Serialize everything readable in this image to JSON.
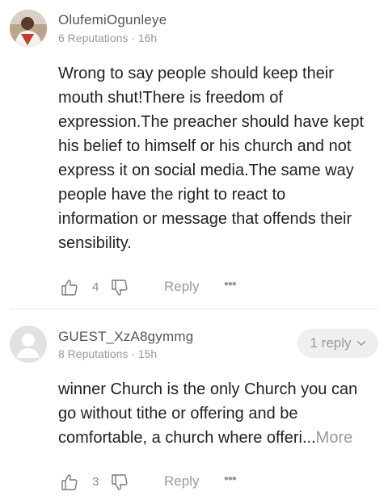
{
  "comments": [
    {
      "username": "OlufemiOgunleye",
      "reputations": "6 Reputations",
      "time": "16h",
      "text_lines": [
        "Wrong to say people should keep their",
        "mouth shut!There is freedom of",
        "expression.The preacher should have kept",
        "his belief to himself or his church and not",
        "express it on social media.The same way",
        "people have the right to react to",
        "information or message that offends their",
        "sensibility."
      ],
      "likes": "4",
      "reply_label": "Reply",
      "more_icon": "more-dots-icon"
    },
    {
      "username": "GUEST_XzA8gymmg",
      "reputations": "8 Reputations",
      "time": "15h",
      "replies_label": "1 reply",
      "text_lines": [
        "winner Church is the only Church you can",
        "go without tithe or offering and be",
        "comfortable, a church where offeri..."
      ],
      "more_label": "More",
      "likes": "3",
      "reply_label": "Reply",
      "more_icon": "more-dots-icon"
    }
  ],
  "separator": "·"
}
